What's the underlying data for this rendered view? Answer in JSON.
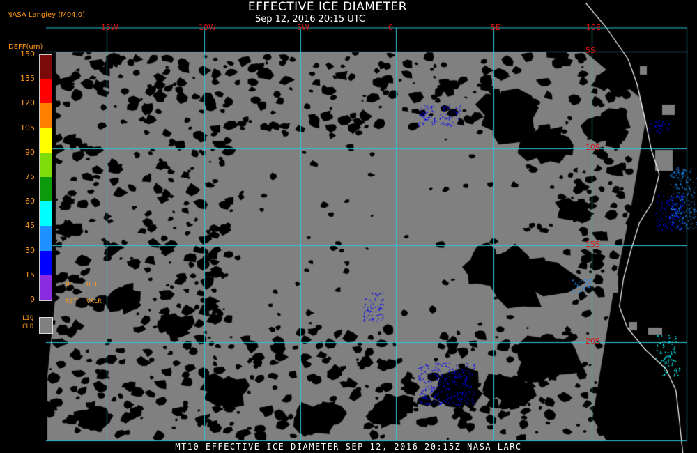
{
  "title": "EFFECTIVE ICE DIAMETER",
  "subtitle": "Sep 12, 2016 20:15 UTC",
  "source": "NASA Langley (M04.0)",
  "colorbar": {
    "label": "DEFF(um)",
    "ticks": [
      "150",
      "135",
      "120",
      "105",
      "90",
      "75",
      "60",
      "45",
      "30",
      "15",
      "0"
    ],
    "colors": [
      "#7a0a0a",
      "#ff0000",
      "#ff7f00",
      "#ffff00",
      "#7fdc0a",
      "#0a9a0a",
      "#00ffff",
      "#1e90ff",
      "#0000ff",
      "#8a2be2"
    ]
  },
  "legend": {
    "no_ret": [
      "NO",
      "RET"
    ],
    "out_valr": [
      "OUT",
      "VALR"
    ],
    "liq_cld": [
      "LIQ",
      "CLD"
    ]
  },
  "longitude_labels": [
    "15W",
    "10W",
    "5W",
    "0",
    "5E",
    "10E"
  ],
  "latitude_labels": [
    "5S",
    "10S",
    "15S",
    "20S"
  ],
  "footer": "MT10  EFFECTIVE ICE DIAMETER  SEP 12, 2016 20:15Z  NASA LARC",
  "colors": {
    "grid": "#2fc7d8",
    "coast": "#ffffff",
    "cloud": "#808080",
    "label": "#ff9a1a",
    "grid_label": "#dd1111"
  }
}
